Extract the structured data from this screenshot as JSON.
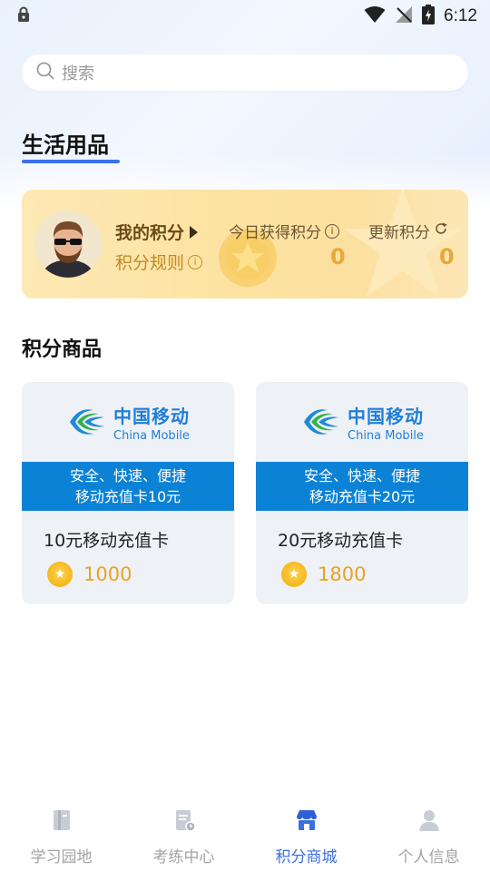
{
  "status_bar": {
    "time": "6:12"
  },
  "search": {
    "placeholder": "搜索"
  },
  "category": {
    "title": "生活用品"
  },
  "points_card": {
    "my_points_label": "我的积分",
    "rules_label": "积分规则",
    "today_label": "今日获得积分",
    "today_value": "0",
    "update_label": "更新积分",
    "update_value": "0"
  },
  "goods": {
    "title": "积分商品",
    "items": [
      {
        "logo_cn": "中国移动",
        "logo_en": "China Mobile",
        "banner_line1": "安全、快速、便捷",
        "banner_line2": "移动充值卡10元",
        "name": "10元移动充值卡",
        "price": "1000"
      },
      {
        "logo_cn": "中国移动",
        "logo_en": "China Mobile",
        "banner_line1": "安全、快速、便捷",
        "banner_line2": "移动充值卡20元",
        "name": "20元移动充值卡",
        "price": "1800"
      }
    ]
  },
  "bottom_nav": {
    "items": [
      {
        "label": "学习园地",
        "icon": "book-icon",
        "active": false
      },
      {
        "label": "考练中心",
        "icon": "exam-icon",
        "active": false
      },
      {
        "label": "积分商城",
        "icon": "shop-icon",
        "active": true
      },
      {
        "label": "个人信息",
        "icon": "person-icon",
        "active": false
      }
    ]
  },
  "colors": {
    "accent": "#3b6fe0",
    "points_value": "#e8a83a",
    "mobile_blue": "#0b82d6"
  }
}
